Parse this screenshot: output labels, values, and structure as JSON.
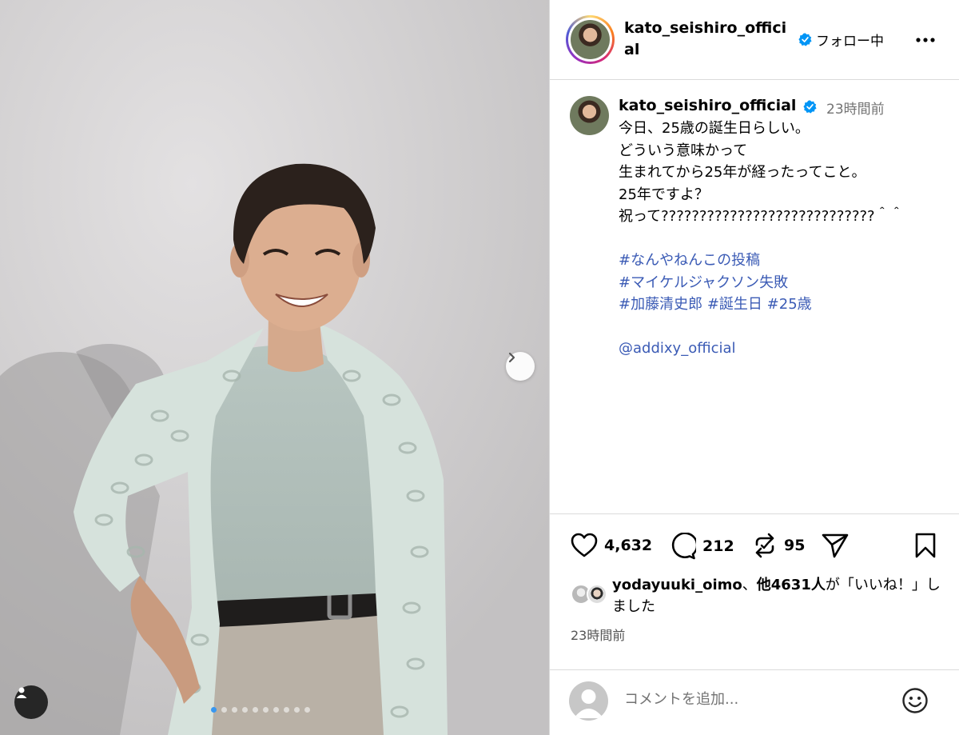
{
  "post": {
    "header_username": "kato_seishiro_official",
    "follow_status": "フォロー中",
    "caption_username": "kato_seishiro_official",
    "caption_time": "23時間前",
    "caption_lines": [
      "今日、25歳の誕生日らしい。",
      "どういう意味かって",
      "生まれてから25年が経ったってこと。",
      "25年ですよ？",
      "祝って????????????????????????????＾＾"
    ],
    "hashtags": {
      "line1": "#なんやねんこの投稿",
      "line2": "#マイケルジャクソン失敗",
      "line3a": "#加藤清史郎",
      "line3b": "#誕生日",
      "line3c": "#25歳"
    },
    "mention": "@addixy_official"
  },
  "actions": {
    "likes": "4,632",
    "comments": "212",
    "reposts": "95"
  },
  "likes_summary": {
    "user": "yodayuuki_oimo",
    "middle": "、",
    "others": "他4631人",
    "suffix": "が「いいね！」しました"
  },
  "post_time": "23時間前",
  "comment_placeholder": "コメントを追加...",
  "carousel": {
    "total": 10,
    "active_index": 0
  },
  "colors": {
    "accent_blue": "#0095f6",
    "link": "#3b5bb5",
    "border": "#dbdbdb"
  },
  "icons": [
    "verified-badge-icon",
    "more-icon",
    "heart-icon",
    "comment-icon",
    "repost-icon",
    "share-icon",
    "bookmark-icon",
    "chevron-right-icon",
    "user-tag-icon",
    "emoji-icon"
  ]
}
